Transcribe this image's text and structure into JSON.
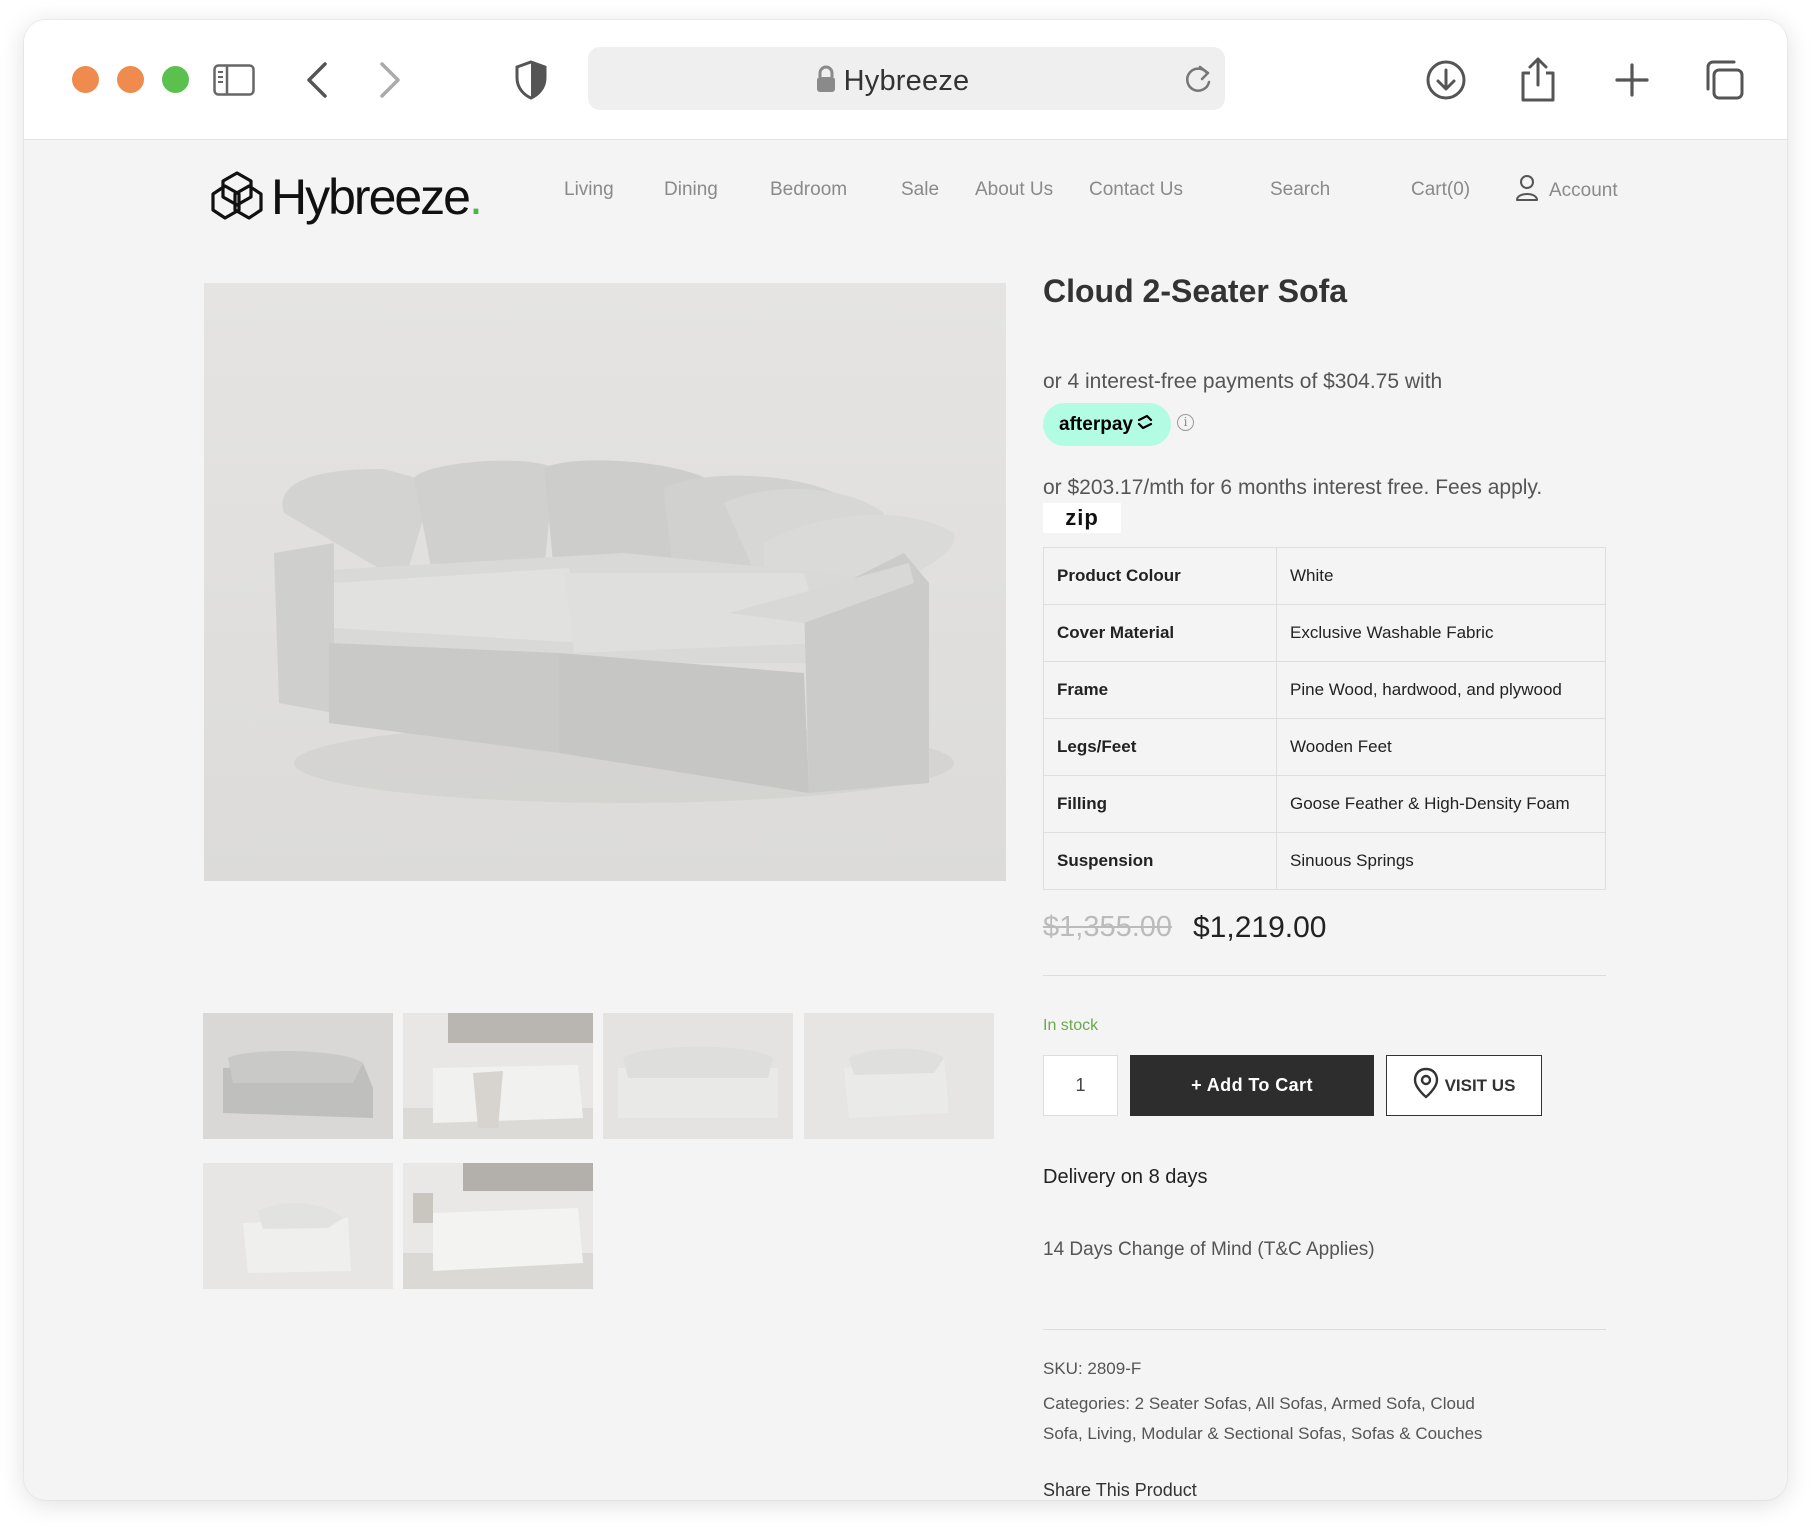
{
  "browser": {
    "url_title": "Hybreeze"
  },
  "site": {
    "logo_text": "Hybreeze",
    "logo_dot": ".",
    "nav": [
      "Living",
      "Dining",
      "Bedroom",
      "Sale",
      "About Us",
      "Contact Us"
    ],
    "search_label": "Search",
    "cart_label": "Cart(0)",
    "account_label": "Account"
  },
  "product": {
    "title": "Cloud 2-Seater Sofa",
    "afterpay_text": "or 4 interest-free payments of $304.75 with",
    "afterpay_badge": "afterpay",
    "afterpay_info": "i",
    "zip_text": "or $203.17/mth for 6 months interest free. Fees apply.",
    "zip_logo": "zip",
    "specs": [
      {
        "key": "Product Colour",
        "value": "White"
      },
      {
        "key": "Cover Material",
        "value": "Exclusive Washable Fabric"
      },
      {
        "key": "Frame",
        "value": "Pine Wood, hardwood, and plywood"
      },
      {
        "key": "Legs/Feet",
        "value": "Wooden Feet"
      },
      {
        "key": "Filling",
        "value": "Goose Feather & High-Density Foam"
      },
      {
        "key": "Suspension",
        "value": "Sinuous Springs"
      }
    ],
    "price_old": "$1,355.00",
    "price_new": "$1,219.00",
    "stock": "In stock",
    "quantity": "1",
    "add_to_cart": "+ Add To Cart",
    "visit_us": "VISIT US",
    "delivery": "Delivery on 8 days",
    "change_of_mind": "14 Days Change of Mind (T&C Applies)",
    "sku": "SKU: 2809-F",
    "categories_line1": "Categories: 2 Seater Sofas, All Sofas, Armed Sofa, Cloud",
    "categories_line2": "Sofa, Living, Modular & Sectional Sofas, Sofas & Couches",
    "share": "Share This Product"
  },
  "colors": {
    "window_bg": "#f4f4f4",
    "traffic_red": "#ef8b4f",
    "traffic_yellow": "#ef8b4f",
    "traffic_green": "#5cc04e",
    "afterpay_mint": "#b2fce4",
    "in_stock_green": "#6aa84f",
    "button_dark": "#2d2d2d"
  },
  "icons": [
    "lock-icon",
    "reload-icon",
    "sidebar-icon",
    "back-icon",
    "forward-icon",
    "shield-icon",
    "download-icon",
    "share-icon",
    "new-tab-icon",
    "tabs-icon",
    "logo-icon",
    "user-icon",
    "location-pin-icon"
  ]
}
